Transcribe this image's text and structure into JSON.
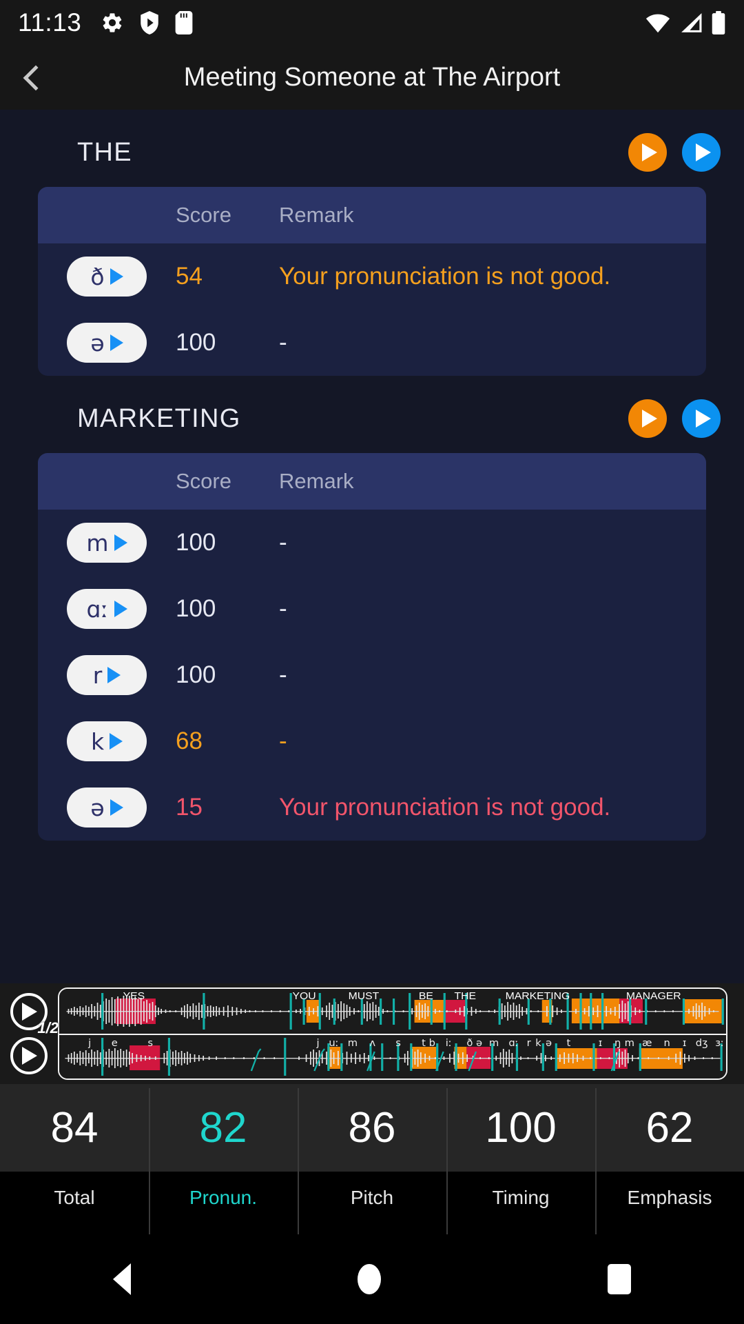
{
  "statusbar": {
    "time": "11:13",
    "icons_left": [
      "gear-icon",
      "shield-play-icon",
      "sd-card-icon"
    ],
    "icons_right": [
      "wifi-icon",
      "cellular-signal-icon",
      "battery-icon"
    ]
  },
  "appbar": {
    "back_label": "Back",
    "title": "Meeting Someone at The Airport"
  },
  "columns": {
    "ipa": "",
    "score": "Score",
    "remark": "Remark"
  },
  "colors": {
    "orange_accent": "#f5a01e",
    "red_accent": "#f2556b",
    "blue_accent": "#0b92f0",
    "teal_accent": "#1fd6cd",
    "card_bg": "#1b2140",
    "table_head_bg": "#2b3467",
    "page_bg": "#141726"
  },
  "words": [
    {
      "title": "THE",
      "play_ref_label": "Play reference audio",
      "play_user_label": "Play your audio",
      "rows": [
        {
          "ipa": "ð",
          "score": "54",
          "score_tone": "orange",
          "remark": "Your pronunciation is not good.",
          "remark_tone": "orange"
        },
        {
          "ipa": "ə",
          "score": "100",
          "score_tone": "normal",
          "remark": "-",
          "remark_tone": "normal"
        }
      ]
    },
    {
      "title": "MARKETING",
      "play_ref_label": "Play reference audio",
      "play_user_label": "Play your audio",
      "rows": [
        {
          "ipa": "m",
          "score": "100",
          "score_tone": "normal",
          "remark": "-",
          "remark_tone": "normal"
        },
        {
          "ipa": "ɑː",
          "score": "100",
          "score_tone": "normal",
          "remark": "-",
          "remark_tone": "normal"
        },
        {
          "ipa": "r",
          "score": "100",
          "score_tone": "normal",
          "remark": "-",
          "remark_tone": "normal"
        },
        {
          "ipa": "k",
          "score": "68",
          "score_tone": "orange",
          "remark": "-",
          "remark_tone": "orange"
        },
        {
          "ipa": "ə",
          "score": "15",
          "score_tone": "red",
          "remark": "Your pronunciation is not good.",
          "remark_tone": "red"
        }
      ]
    }
  ],
  "player": {
    "speed_badge": "1/2",
    "play_reference_label": "Play reference at half speed",
    "play_user_label": "Play user recording",
    "reference_words": [
      "YES",
      "YOU",
      "MUST",
      "BE",
      "THE",
      "MARKETING",
      "MANAGER"
    ],
    "user_phonemes": [
      "j",
      "e",
      "s",
      "j",
      "uː",
      "m",
      "ʌ",
      "s",
      "t",
      "b",
      "iː",
      "ð",
      "ə",
      "m",
      "ɑː",
      "r",
      "k",
      "ə",
      "t",
      "ɪ",
      "ŋ",
      "m",
      "æ",
      "n",
      "ɪ",
      "d",
      "ʒ",
      "ɜː"
    ]
  },
  "scores": [
    {
      "value": "84",
      "label": "Total",
      "tone": "normal"
    },
    {
      "value": "82",
      "label": "Pronun.",
      "tone": "teal"
    },
    {
      "value": "86",
      "label": "Pitch",
      "tone": "normal"
    },
    {
      "value": "100",
      "label": "Timing",
      "tone": "normal"
    },
    {
      "value": "62",
      "label": "Emphasis",
      "tone": "normal"
    }
  ],
  "navbar": {
    "back": "back-nav",
    "home": "home-nav",
    "recent": "recent-apps-nav"
  }
}
